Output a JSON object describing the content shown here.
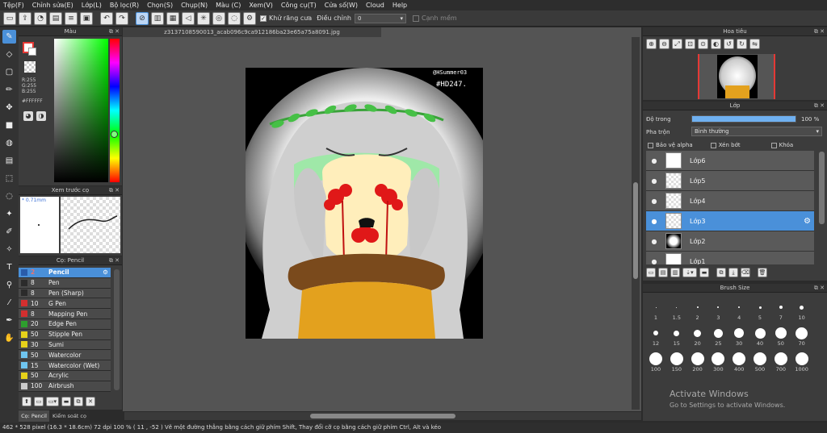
{
  "menu": [
    "Tệp(F)",
    "Chỉnh sửa(E)",
    "Lớp(L)",
    "Bộ lọc(R)",
    "Chọn(S)",
    "Chụp(N)",
    "Màu (C)",
    "Xem(V)",
    "Công cụ(T)",
    "Cửa số(W)",
    "Cloud",
    "Help"
  ],
  "toolbar": {
    "antialias_label": "Khử răng cưa",
    "adjust_label": "Điều chỉnh",
    "adjust_value": "0",
    "smooth_label": "Cạnh mềm"
  },
  "color_panel": {
    "title": "Màu",
    "r": "R:255",
    "g": "G:255",
    "b": "B:255",
    "hex": "#FFFFFF"
  },
  "preview_panel": {
    "title": "Xem trước cọ",
    "size": "* 0.71mm"
  },
  "brush_panel": {
    "title": "Cọ: Pencil",
    "items": [
      {
        "size": "2",
        "name": "Pencil",
        "color": "#2a5caa",
        "selected": true
      },
      {
        "size": "8",
        "name": "Pen",
        "color": "#2b2b2b"
      },
      {
        "size": "8",
        "name": "Pen (Sharp)",
        "color": "#2b2b2b"
      },
      {
        "size": "10",
        "name": "G Pen",
        "color": "#d32f2f"
      },
      {
        "size": "8",
        "name": "Mapping Pen",
        "color": "#d32f2f"
      },
      {
        "size": "20",
        "name": "Edge Pen",
        "color": "#2e9e2e"
      },
      {
        "size": "50",
        "name": "Stipple Pen",
        "color": "#e6d21a"
      },
      {
        "size": "30",
        "name": "Sumi",
        "color": "#e6d21a"
      },
      {
        "size": "50",
        "name": "Watercolor",
        "color": "#6fc6f0"
      },
      {
        "size": "15",
        "name": "Watercolor (Wet)",
        "color": "#6fc6f0"
      },
      {
        "size": "50",
        "name": "Acrylic",
        "color": "#e6d21a"
      },
      {
        "size": "100",
        "name": "Airbrush",
        "color": "#cccccc"
      }
    ]
  },
  "bottom_tabs": [
    "Cọ: Pencil",
    "Kiểm soát cọ"
  ],
  "document": {
    "tab": "z3137108590013_acab096c9ca912186ba23e65a75a8091.jpg",
    "watermark1": "@HSummer03",
    "watermark2": "#HD247."
  },
  "navigator": {
    "title": "Hoa tiêu"
  },
  "layer_panel": {
    "title": "Lớp",
    "opacity_label": "Độ trong",
    "opacity_value": "100 %",
    "opacity_fraction": 1.0,
    "blend_label": "Pha trộn",
    "blend_value": "Bình thường",
    "alpha_label": "Bảo vệ alpha",
    "clip_label": "Xén bớt",
    "lock_label": "Khóa",
    "layers": [
      {
        "name": "Lớp6"
      },
      {
        "name": "Lớp5"
      },
      {
        "name": "Lớp4"
      },
      {
        "name": "Lớp3",
        "selected": true
      },
      {
        "name": "Lớp2"
      },
      {
        "name": "Lớp1"
      }
    ]
  },
  "brush_size": {
    "title": "Brush Size",
    "sizes": [
      "1",
      "1.5",
      "2",
      "3",
      "4",
      "5",
      "7",
      "10",
      "12",
      "15",
      "20",
      "25",
      "30",
      "40",
      "50",
      "70",
      "100",
      "150",
      "200",
      "300",
      "400",
      "500",
      "700",
      "1000"
    ]
  },
  "activate": {
    "line1": "Activate Windows",
    "line2": "Go to Settings to activate Windows."
  },
  "status": "462 * 528 pixel   (16.3 * 18.6cm)   72 dpi   100 %   ( 11 , -52 )   Vẽ một đường thẳng bằng cách giữ phím Shift, Thay đổi cỡ cọ bằng cách giữ phím Ctrl, Alt và kéo"
}
